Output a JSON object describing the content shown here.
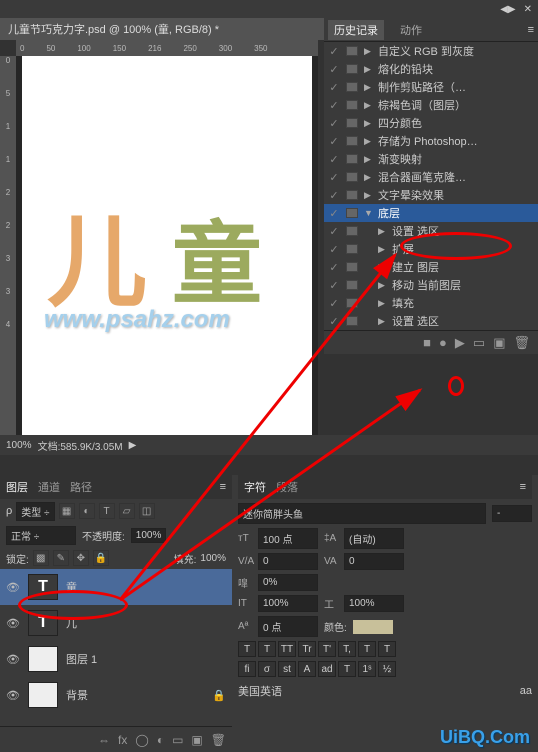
{
  "doc_tab": "儿童节巧克力字.psd @ 100% (童, RGB/8) *",
  "ruler_marks": [
    "0",
    "50",
    "100",
    "150",
    "216",
    "250",
    "300",
    "350"
  ],
  "ruler_v": [
    "",
    "5",
    "0",
    "0",
    "5",
    "0",
    "1",
    "1",
    "5",
    "2",
    "2",
    "5",
    "3",
    "3",
    "5",
    "4"
  ],
  "canvas": {
    "char1": "儿",
    "char2": "童",
    "watermark": "www.psahz.com"
  },
  "status": {
    "zoom": "100%",
    "docinfo": "文档:585.9K/3.05M"
  },
  "history": {
    "tabs": {
      "history": "历史记录",
      "actions": "动作"
    },
    "items": [
      {
        "t": "▶",
        "l": "自定义 RGB 到灰度"
      },
      {
        "t": "▶",
        "l": "熔化的铅块"
      },
      {
        "t": "▶",
        "l": "制作剪贴路径（…"
      },
      {
        "t": "▶",
        "l": "棕褐色调（图层）"
      },
      {
        "t": "▶",
        "l": "四分颜色"
      },
      {
        "t": "▶",
        "l": "存储为 Photoshop…"
      },
      {
        "t": "▶",
        "l": "渐变映射"
      },
      {
        "t": "▶",
        "l": "混合器画笔克隆…"
      },
      {
        "t": "▶",
        "l": "文字晕染效果"
      },
      {
        "t": "▼",
        "l": "底层",
        "sel": true
      },
      {
        "t": "▶",
        "l": "设置 选区",
        "indent": true
      },
      {
        "t": "▶",
        "l": "扩展",
        "indent": true
      },
      {
        "t": "▶",
        "l": "建立 图层",
        "indent": true
      },
      {
        "t": "▶",
        "l": "移动 当前图层",
        "indent": true
      },
      {
        "t": "▶",
        "l": "填充",
        "indent": true
      },
      {
        "t": "▶",
        "l": "设置 选区",
        "indent": true
      }
    ]
  },
  "layers": {
    "tabs": {
      "layers": "图层",
      "channels": "通道",
      "paths": "路径"
    },
    "filter_label": "类型",
    "blend": {
      "mode": "正常",
      "opacity_label": "不透明度:",
      "opacity": "100%"
    },
    "lock": {
      "label": "锁定:",
      "fill_label": "填充:",
      "fill": "100%"
    },
    "items": [
      {
        "type": "T",
        "name": "童",
        "sel": true
      },
      {
        "type": "T",
        "name": "儿"
      },
      {
        "type": "img",
        "name": "图层 1"
      },
      {
        "type": "bg",
        "name": "背景",
        "lock": true
      }
    ]
  },
  "char": {
    "tabs": {
      "char": "字符",
      "para": "段落"
    },
    "font": "迷你简胖头鱼",
    "size": "100 点",
    "leading": "(自动)",
    "va": "0",
    "tracking": "0",
    "scale": "0%",
    "height": "100%",
    "width": "100%",
    "baseline": "0 点",
    "color_label": "颜色:",
    "style_btns": [
      "T",
      "T",
      "TT",
      "Tr",
      "T'",
      "T,",
      "T",
      "T"
    ],
    "lang": "美国英语",
    "aa": "aa"
  },
  "watermark2": "UiBQ.Com"
}
